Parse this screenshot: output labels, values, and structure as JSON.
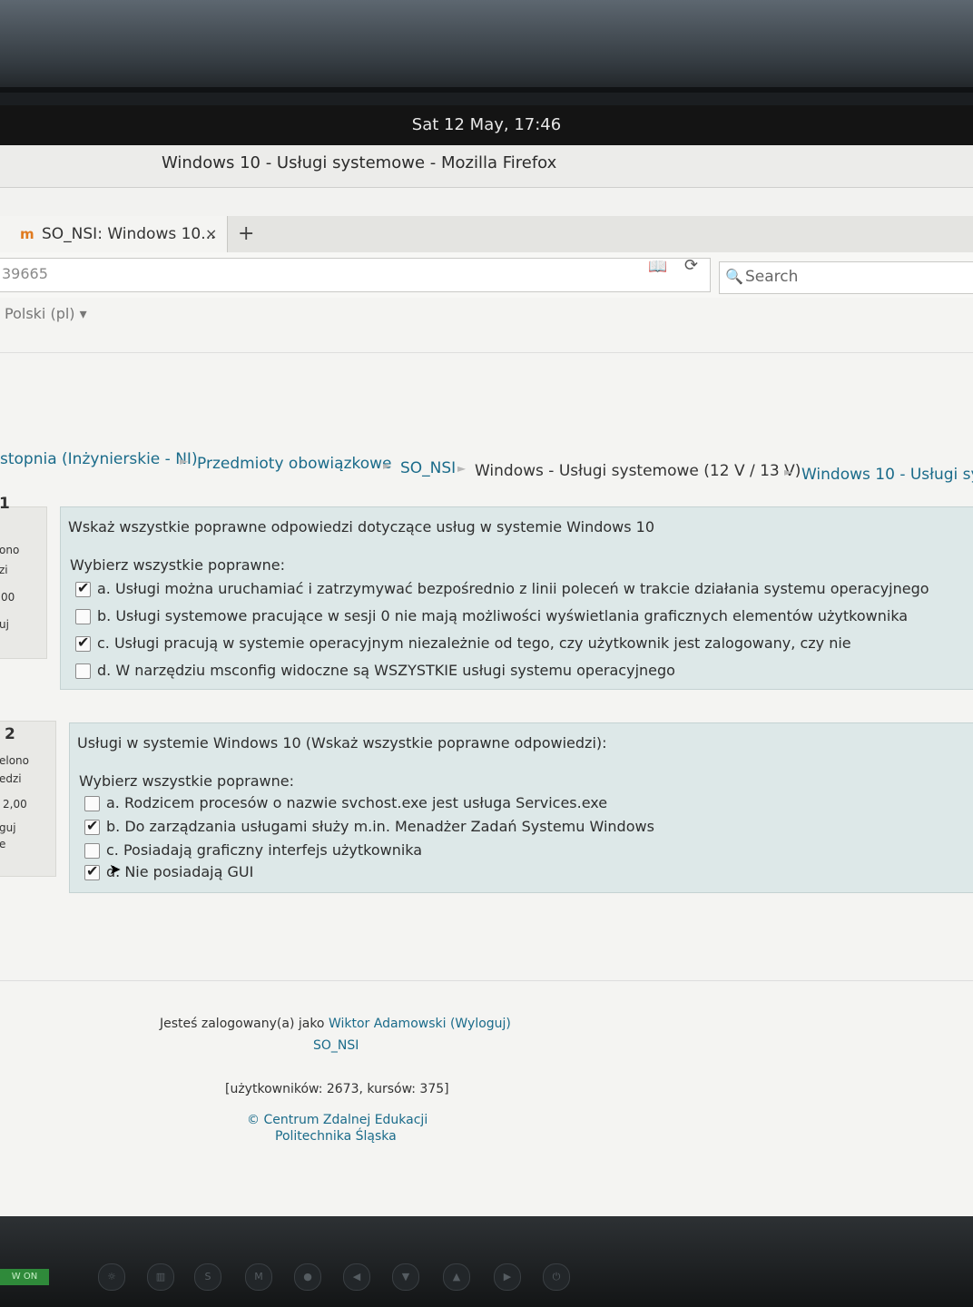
{
  "system": {
    "clock": "Sat 12 May, 17:46"
  },
  "window": {
    "title": "Windows 10 - Usługi systemowe - Mozilla Firefox"
  },
  "tab": {
    "favicon": "m",
    "label": "SO_NSI: Windows 10...",
    "close": "×",
    "new_tab": "+"
  },
  "navbar": {
    "url_fragment": "39665",
    "reader_icon": "📖",
    "reload_icon": "⟳",
    "search_placeholder": "Search",
    "search_icon": "🔍"
  },
  "language": "Polski (pl) ▾",
  "breadcrumb": [
    {
      "label": "stopnia (Inżynierskie - NI)",
      "link": true
    },
    {
      "label": "Przedmioty obowiązkowe",
      "link": true
    },
    {
      "label": "SO_NSI",
      "link": true
    },
    {
      "label": "Windows - Usługi systemowe (12 V / 13 V)",
      "link": false
    },
    {
      "label": "Windows 10 - Usługi sys",
      "link": true
    }
  ],
  "breadcrumb_sep": "►",
  "questions": [
    {
      "number": "1",
      "info": [
        "ono",
        "zi",
        "00",
        "uj"
      ],
      "text": "Wskaż wszystkie poprawne odpowiedzi dotyczące usług w systemie Windows 10",
      "prompt": "Wybierz wszystkie poprawne:",
      "options": [
        {
          "label": "a. Usługi można uruchamiać i zatrzymywać bezpośrednio z linii poleceń w trakcie działania systemu operacyjnego",
          "checked": true
        },
        {
          "label": "b. Usługi systemowe pracujące w sesji 0 nie mają możliwości wyświetlania graficznych elementów użytkownika",
          "checked": false
        },
        {
          "label": "c. Usługi pracują w systemie operacyjnym niezależnie od tego, czy użytkownik jest zalogowany, czy nie",
          "checked": true
        },
        {
          "label": "d. W narzędziu msconfig widoczne są WSZYSTKIE usługi systemu operacyjnego",
          "checked": false
        }
      ]
    },
    {
      "number": "2",
      "info": [
        "elono",
        "edzi",
        "2,00",
        "guj",
        "e"
      ],
      "text": "Usługi w systemie Windows 10 (Wskaż wszystkie poprawne odpowiedzi):",
      "prompt": "Wybierz wszystkie poprawne:",
      "options": [
        {
          "label": "a. Rodzicem procesów o nazwie svchost.exe jest usługa Services.exe",
          "checked": false
        },
        {
          "label": "b. Do zarządzania usługami służy m.in. Menadżer Zadań Systemu Windows",
          "checked": true
        },
        {
          "label": "c. Posiadają graficzny interfejs użytkownika",
          "checked": false
        },
        {
          "label": "d. Nie posiadają GUI",
          "checked": true
        }
      ]
    }
  ],
  "checkmark": "✔",
  "footer": {
    "logged_in_prefix": "Jesteś zalogowany(a) jako",
    "user_name": "Wiktor Adamowski",
    "logout": "(Wyloguj)",
    "course": "SO_NSI",
    "stats": "[użytkowników: 2673, kursów: 375]",
    "copyright": "© Centrum Zdalnej Edukacji",
    "institution": "Politechnika Śląska"
  },
  "monitor": {
    "power_label": "W ON"
  }
}
